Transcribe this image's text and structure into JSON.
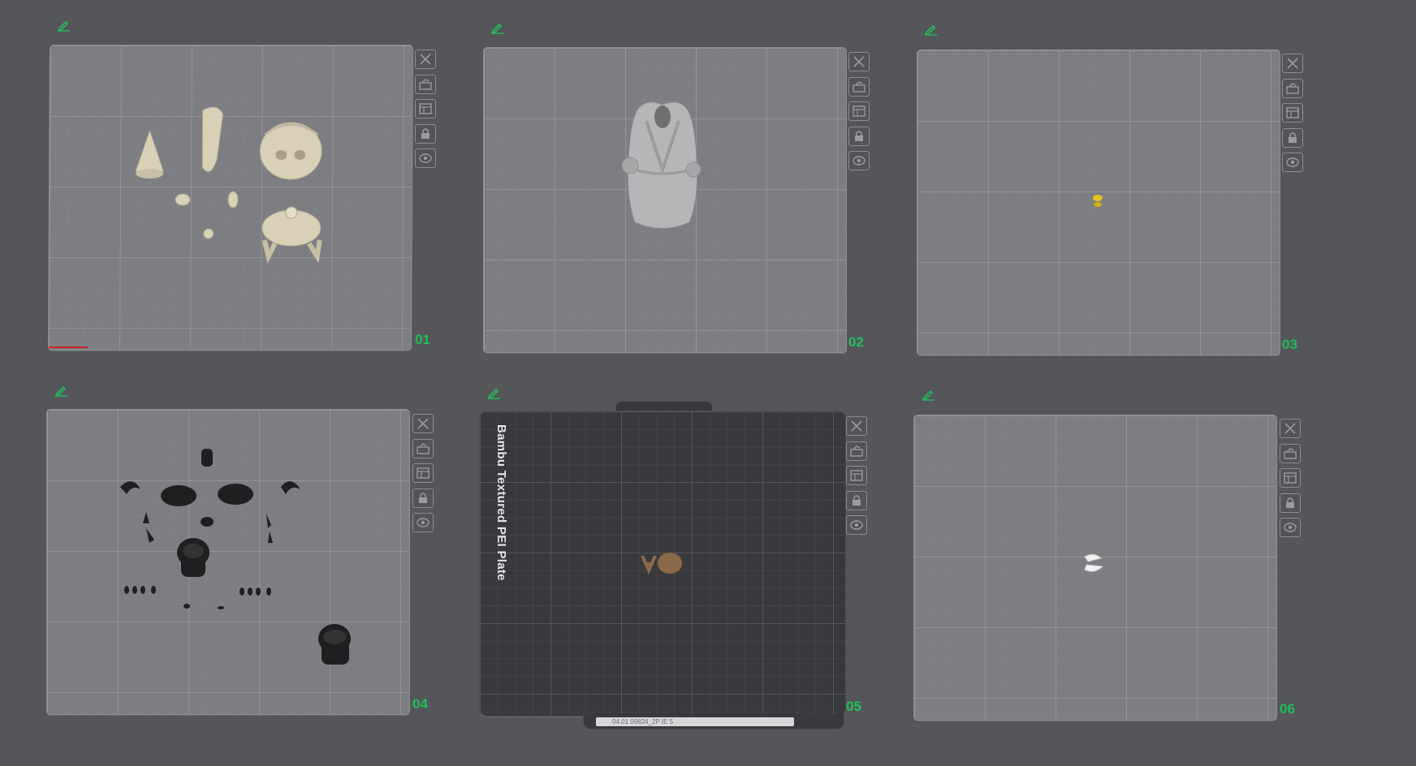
{
  "plates": [
    {
      "number": "01",
      "type": "smooth"
    },
    {
      "number": "02",
      "type": "smooth"
    },
    {
      "number": "03",
      "type": "smooth"
    },
    {
      "number": "04",
      "type": "smooth"
    },
    {
      "number": "05",
      "type": "textured",
      "brand_label": "Bambu Textured PEI Plate",
      "strip_text": "04.01 09824_2P IE 5"
    },
    {
      "number": "06",
      "type": "smooth"
    }
  ],
  "toolbar_icons": [
    "close-icon",
    "auto-orient-icon",
    "arrange-icon",
    "lock-icon",
    "settings-eye-icon"
  ],
  "colors": {
    "background": "#55565a",
    "accent_green": "#1fbf5a",
    "plate": "#7d7e82",
    "textured_plate": "#38393c",
    "model_beige": "#d9d0b8",
    "model_grey": "#b5b6b8",
    "model_yellow": "#e6c21a",
    "model_black": "#1f1f21",
    "model_brown": "#8a6a4a",
    "model_white": "#f2f2f2"
  }
}
